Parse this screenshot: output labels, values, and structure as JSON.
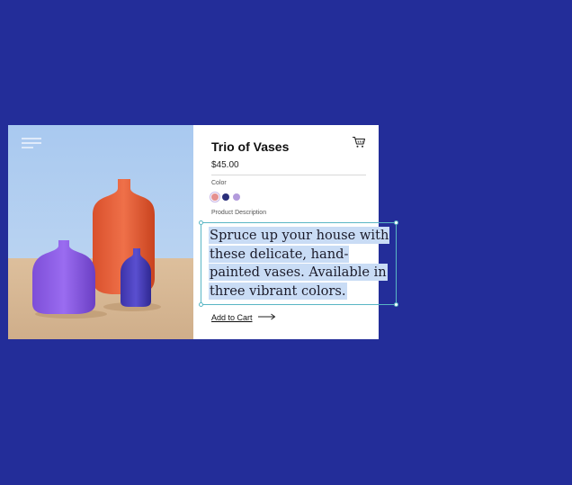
{
  "product": {
    "title": "Trio of Vases",
    "price": "$45.00",
    "color_label": "Color",
    "colors": [
      "#e59090",
      "#2b2f7a",
      "#b39bdc"
    ],
    "selected_color_index": 0,
    "description_label": "Product Description",
    "description_lines": [
      "Spruce up your house with",
      "these delicate, hand-",
      "painted vases. Available in",
      "three vibrant colors."
    ],
    "add_to_cart_label": "Add to Cart"
  },
  "colors": {
    "background": "#232d99",
    "selection_border": "#59b6c4",
    "selection_highlight": "#c9dcf5"
  },
  "icons": {
    "menu": "menu-icon",
    "cart": "cart-icon",
    "arrow": "arrow-right-icon"
  }
}
